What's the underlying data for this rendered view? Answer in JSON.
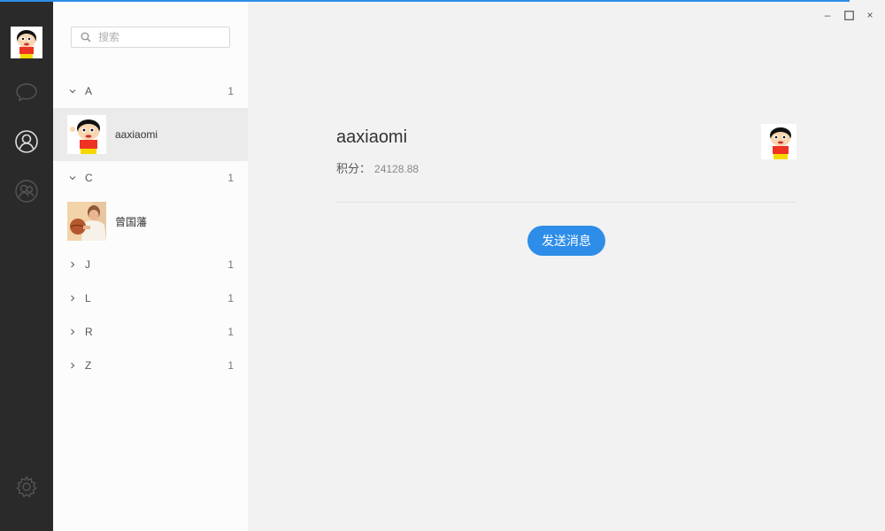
{
  "colors": {
    "accent": "#2e8de8",
    "rail": "#2a2a2a",
    "panel": "#fcfcfc",
    "content": "#f2f2f2"
  },
  "rail": {
    "items": [
      {
        "icon": "chat-bubble-icon"
      },
      {
        "icon": "contacts-person-icon",
        "active": true
      },
      {
        "icon": "group-icon"
      },
      {
        "icon": "gear-icon"
      }
    ]
  },
  "search": {
    "placeholder": "搜索",
    "value": ""
  },
  "contacts": {
    "groups": [
      {
        "letter": "A",
        "count": "1",
        "expanded": true,
        "contacts": [
          {
            "name": "aaxiaomi",
            "active": true
          }
        ]
      },
      {
        "letter": "C",
        "count": "1",
        "expanded": true,
        "contacts": [
          {
            "name": "曾国藩"
          }
        ]
      },
      {
        "letter": "J",
        "count": "1",
        "expanded": false
      },
      {
        "letter": "L",
        "count": "1",
        "expanded": false
      },
      {
        "letter": "R",
        "count": "1",
        "expanded": false
      },
      {
        "letter": "Z",
        "count": "1",
        "expanded": false
      }
    ]
  },
  "window_controls": {
    "minimize": "–",
    "maximize": "☐",
    "close": "×"
  },
  "detail": {
    "name": "aaxiaomi",
    "score_label": "积分：",
    "score_value": "24128.88",
    "send_button": "发送消息"
  }
}
